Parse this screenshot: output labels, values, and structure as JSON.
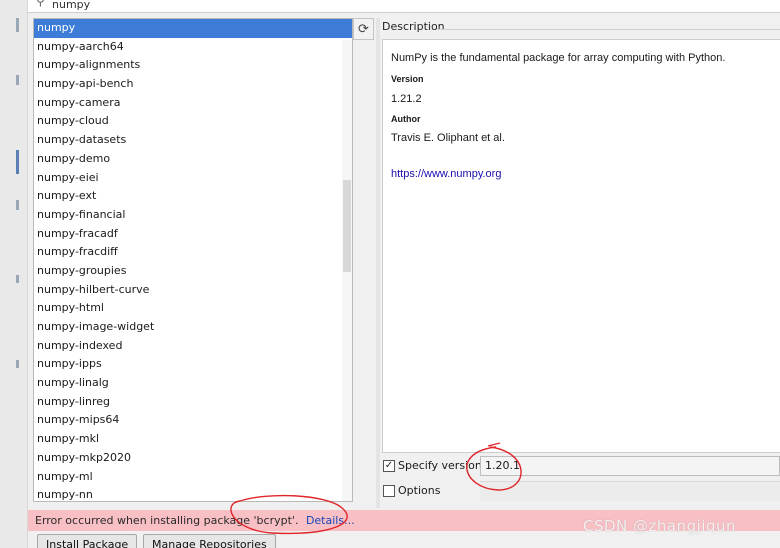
{
  "search": {
    "value": "numpy"
  },
  "packages": [
    "numpy",
    "numpy-aarch64",
    "numpy-alignments",
    "numpy-api-bench",
    "numpy-camera",
    "numpy-cloud",
    "numpy-datasets",
    "numpy-demo",
    "numpy-eiei",
    "numpy-ext",
    "numpy-financial",
    "numpy-fracadf",
    "numpy-fracdiff",
    "numpy-groupies",
    "numpy-hilbert-curve",
    "numpy-html",
    "numpy-image-widget",
    "numpy-indexed",
    "numpy-ipps",
    "numpy-linalg",
    "numpy-linreg",
    "numpy-mips64",
    "numpy-mkl",
    "numpy-mkp2020",
    "numpy-ml",
    "numpy-nn"
  ],
  "selected_index": 0,
  "description": {
    "header": "Description",
    "summary": "NumPy is the fundamental package for array computing with Python.",
    "version_label": "Version",
    "version": "1.21.2",
    "author_label": "Author",
    "author": "Travis E. Oliphant et al.",
    "homepage": "https://www.numpy.org"
  },
  "options": {
    "specify_version_label": "Specify version",
    "specify_version_checked": true,
    "specify_version_value": "1.20.1",
    "options_label": "Options",
    "options_checked": false
  },
  "error": {
    "message": "Error occurred when installing package 'bcrypt'.",
    "details_link": "Details..."
  },
  "buttons": {
    "install": "Install Package",
    "manage": "Manage Repositories"
  },
  "watermark": "CSDN @zhangjiqun",
  "icons": {
    "search": "search-icon",
    "reload": "reload-icon"
  },
  "colors": {
    "selection": "#3d7dd8",
    "error_bg": "#f8c0c4",
    "link": "#1a0dab",
    "annotation": "#e0262b"
  }
}
